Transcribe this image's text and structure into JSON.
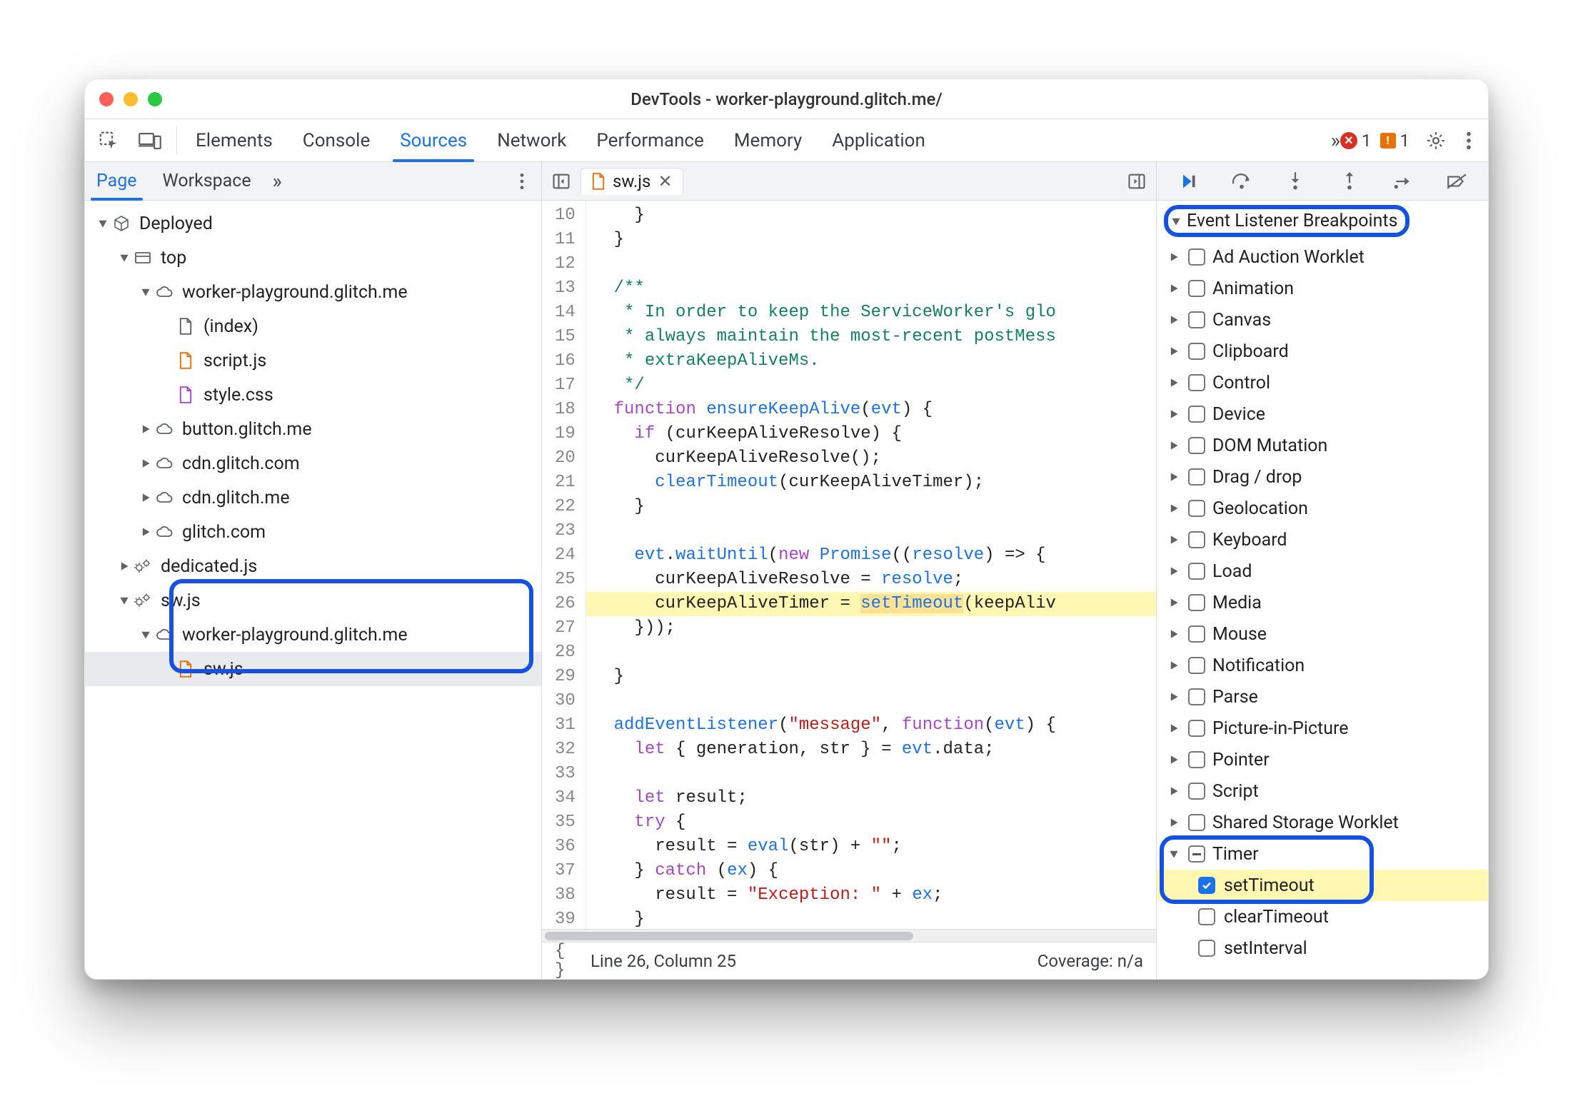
{
  "window_title": "DevTools - worker-playground.glitch.me/",
  "toolbar": {
    "tabs": [
      "Elements",
      "Console",
      "Sources",
      "Network",
      "Performance",
      "Memory",
      "Application"
    ],
    "active": "Sources",
    "errors_count": "1",
    "warnings_count": "1"
  },
  "page_sidebar": {
    "tabs": [
      "Page",
      "Workspace"
    ],
    "active": "Page",
    "tree": {
      "root": "Deployed",
      "top_label": "top",
      "top_origin": "worker-playground.glitch.me",
      "top_files": [
        "(index)",
        "script.js",
        "style.css"
      ],
      "top_collapsed_origins": [
        "button.glitch.me",
        "cdn.glitch.com",
        "cdn.glitch.me",
        "glitch.com"
      ],
      "dedicated": "dedicated.js",
      "sw_label": "sw.js",
      "sw_origin": "worker-playground.glitch.me",
      "sw_file": "sw.js"
    }
  },
  "editor": {
    "tab_name": "sw.js",
    "first_line_no": 10,
    "lines": [
      "    }",
      "  }",
      "",
      "  /**",
      "   * In order to keep the ServiceWorker's glo",
      "   * always maintain the most-recent postMess",
      "   * extraKeepAliveMs.",
      "   */",
      "  function ensureKeepAlive(evt) {",
      "    if (curKeepAliveResolve) {",
      "      curKeepAliveResolve();",
      "      clearTimeout(curKeepAliveTimer);",
      "    }",
      "",
      "    evt.waitUntil(new Promise((resolve) => {",
      "      curKeepAliveResolve = resolve;",
      "      curKeepAliveTimer = setTimeout(keepAliv",
      "    }));",
      "",
      "  }",
      "",
      "  addEventListener(\"message\", function(evt) {",
      "    let { generation, str } = evt.data;",
      "",
      "    let result;",
      "    try {",
      "      result = eval(str) + \"\";",
      "    } catch (ex) {",
      "      result = \"Exception: \" + ex;",
      "    }"
    ],
    "highlight_line_index": 16,
    "status_line": "Line 26, Column 25",
    "status_coverage": "Coverage: n/a"
  },
  "breakpoints": {
    "title": "Event Listener Breakpoints",
    "categories": [
      "Ad Auction Worklet",
      "Animation",
      "Canvas",
      "Clipboard",
      "Control",
      "Device",
      "DOM Mutation",
      "Drag / drop",
      "Geolocation",
      "Keyboard",
      "Load",
      "Media",
      "Mouse",
      "Notification",
      "Parse",
      "Picture-in-Picture",
      "Pointer",
      "Script",
      "Shared Storage Worklet"
    ],
    "timer": {
      "label": "Timer",
      "children": [
        "setTimeout",
        "clearTimeout",
        "setInterval"
      ],
      "checked": "setTimeout"
    }
  }
}
